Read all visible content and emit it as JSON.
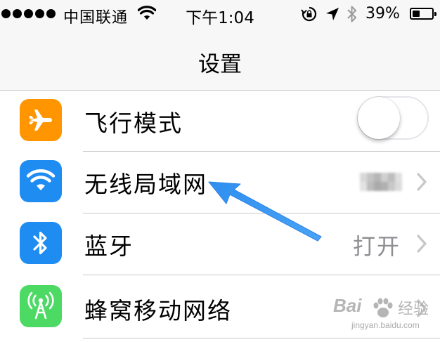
{
  "status_bar": {
    "carrier": "中国联通",
    "time": "下午1:04",
    "battery_percent": "39%",
    "battery_level": 0.39,
    "signal_bars_filled": 5,
    "icons": [
      "signal-dots",
      "wifi-icon",
      "rotation-lock-icon",
      "location-arrow-icon",
      "bluetooth-icon",
      "battery-icon"
    ]
  },
  "nav": {
    "title": "设置"
  },
  "rows": [
    {
      "label": "飞行模式",
      "icon": "airplane-icon",
      "icon_color": "#ff9500",
      "accessory": "toggle",
      "toggle_on": false
    },
    {
      "label": "无线局域网",
      "icon": "wifi-icon",
      "icon_color": "#1f8cf2",
      "accessory": "chevron",
      "detail_blurred": true
    },
    {
      "label": "蓝牙",
      "icon": "bluetooth-icon",
      "icon_color": "#1f8cf2",
      "accessory": "chevron",
      "detail": "打开"
    },
    {
      "label": "蜂窝移动网络",
      "icon": "cellular-antenna-icon",
      "icon_color": "#4cd964",
      "accessory": "chevron"
    }
  ],
  "annotation": {
    "arrow_color": "#2f8ff0",
    "points_to": "无线局域网"
  },
  "watermark": {
    "brand": "Bai",
    "suffix": "经验",
    "url": "jingyan.baidu.com"
  }
}
